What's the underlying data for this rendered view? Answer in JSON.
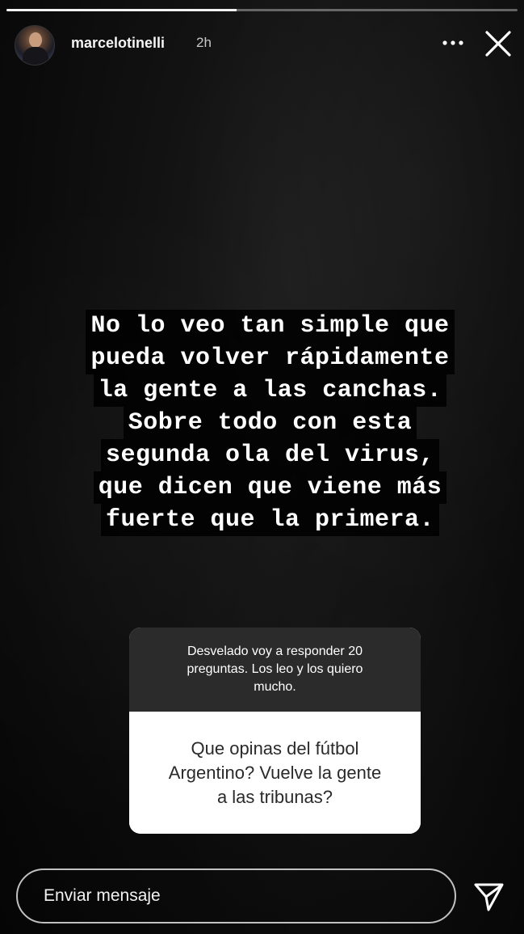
{
  "header": {
    "username": "marcelotinelli",
    "time": "2h",
    "avatar_icon": "profile-avatar",
    "more_icon": "more-dots-icon",
    "close_icon": "close-icon"
  },
  "progress": {
    "value": 0.45
  },
  "story_text": {
    "lines": [
      "No lo veo tan simple que",
      "pueda volver rápidamente",
      "la gente a las canchas.",
      "Sobre todo con esta",
      "segunda ola del virus,",
      "que dicen que viene más",
      "fuerte que la primera."
    ]
  },
  "sticker": {
    "prompt_lines": [
      "Desvelado voy a responder 20",
      "preguntas. Los leo y los quiero",
      "mucho."
    ],
    "answer_lines": [
      "Que opinas del fútbol",
      "Argentino? Vuelve la gente",
      "a las tribunas?"
    ]
  },
  "reply": {
    "placeholder": "Enviar mensaje",
    "send_icon": "send-icon"
  },
  "colors": {
    "background": "#0a0a0a",
    "sticker_header": "#2b2b2b",
    "sticker_body": "#ffffff"
  }
}
